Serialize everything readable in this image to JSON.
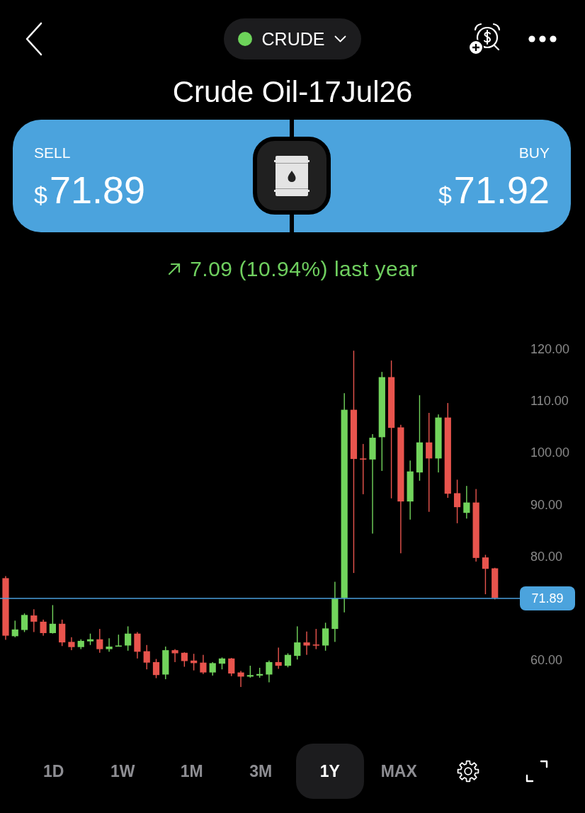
{
  "header": {
    "symbol": "CRUDE",
    "market_open": true
  },
  "title": "Crude Oil-17Jul26",
  "quotes": [
    {
      "kind": "sell",
      "label": "SELL",
      "currency": "$",
      "price": "71.89"
    },
    {
      "kind": "buy",
      "label": "BUY",
      "currency": "$",
      "price": "71.92"
    }
  ],
  "change": {
    "positive": true,
    "text": "7.09 (10.94%) last year"
  },
  "chart": {
    "chart_data": {
      "type": "candlestick",
      "ylim": [
        60,
        120
      ],
      "yticks": [
        {
          "value": 60,
          "label": "60.00"
        },
        {
          "value": 80,
          "label": "80.00"
        },
        {
          "value": 90,
          "label": "90.00"
        },
        {
          "value": 100,
          "label": "100.00"
        },
        {
          "value": 110,
          "label": "110.00"
        },
        {
          "value": 120,
          "label": "120.00"
        }
      ],
      "ref_lines": [
        {
          "axis": "y",
          "value": 71.89,
          "label": "71.89"
        }
      ],
      "ohlc": [
        [
          75.8,
          76.2,
          63.9,
          64.7
        ],
        [
          64.6,
          67.6,
          64.4,
          65.9
        ],
        [
          65.8,
          69.0,
          65.4,
          68.7
        ],
        [
          68.6,
          69.8,
          65.4,
          67.4
        ],
        [
          67.4,
          67.8,
          64.7,
          65.2
        ],
        [
          65.2,
          70.6,
          65.1,
          67.0
        ],
        [
          67.0,
          67.8,
          62.7,
          63.4
        ],
        [
          63.5,
          64.4,
          61.9,
          62.5
        ],
        [
          62.5,
          64.0,
          62.1,
          63.7
        ],
        [
          63.6,
          65.1,
          62.9,
          64.0
        ],
        [
          64.0,
          66.0,
          61.4,
          62.1
        ],
        [
          62.1,
          64.2,
          61.6,
          62.6
        ],
        [
          62.6,
          64.9,
          62.6,
          62.8
        ],
        [
          62.8,
          66.5,
          61.8,
          65.1
        ],
        [
          65.1,
          65.4,
          60.3,
          61.6
        ],
        [
          61.7,
          62.9,
          58.2,
          59.5
        ],
        [
          59.6,
          60.2,
          56.5,
          57.1
        ],
        [
          57.2,
          62.6,
          56.3,
          61.9
        ],
        [
          61.9,
          62.1,
          59.6,
          61.3
        ],
        [
          61.4,
          61.5,
          58.7,
          59.8
        ],
        [
          59.9,
          61.2,
          58.0,
          59.4
        ],
        [
          59.5,
          61.0,
          57.3,
          57.6
        ],
        [
          57.6,
          59.6,
          57.0,
          59.4
        ],
        [
          59.3,
          60.5,
          58.2,
          60.3
        ],
        [
          60.3,
          60.4,
          56.9,
          57.4
        ],
        [
          57.6,
          57.9,
          54.8,
          56.8
        ],
        [
          56.8,
          58.9,
          56.6,
          57.1
        ],
        [
          57.0,
          58.5,
          56.6,
          57.3
        ],
        [
          57.2,
          59.9,
          55.7,
          59.6
        ],
        [
          59.6,
          62.4,
          58.3,
          58.9
        ],
        [
          58.9,
          61.3,
          58.6,
          61.0
        ],
        [
          60.8,
          66.5,
          60.1,
          63.4
        ],
        [
          63.4,
          65.5,
          61.0,
          62.8
        ],
        [
          63.0,
          66.0,
          62.1,
          62.8
        ],
        [
          62.8,
          67.2,
          61.8,
          66.1
        ],
        [
          66.0,
          75.1,
          63.5,
          71.9
        ],
        [
          72.0,
          111.5,
          69.2,
          108.3
        ],
        [
          108.3,
          119.7,
          76.8,
          98.8
        ],
        [
          98.9,
          101.7,
          92.0,
          98.7
        ],
        [
          98.7,
          103.6,
          84.4,
          102.9
        ],
        [
          103.0,
          115.6,
          96.5,
          114.6
        ],
        [
          114.6,
          117.8,
          91.2,
          104.8
        ],
        [
          104.9,
          105.4,
          80.6,
          90.6
        ],
        [
          90.6,
          98.5,
          87.1,
          96.4
        ],
        [
          96.2,
          111.1,
          94.6,
          102.0
        ],
        [
          102.0,
          107.7,
          88.6,
          98.9
        ],
        [
          98.9,
          107.4,
          96.2,
          106.8
        ],
        [
          106.8,
          109.6,
          91.3,
          92.1
        ],
        [
          92.2,
          94.8,
          86.4,
          89.5
        ],
        [
          88.4,
          93.6,
          87.3,
          90.4
        ],
        [
          90.4,
          93.0,
          79.0,
          79.7
        ],
        [
          79.8,
          80.3,
          72.7,
          77.6
        ],
        [
          77.7,
          77.8,
          71.7,
          72.0
        ]
      ]
    }
  },
  "ranges": [
    {
      "label": "1D",
      "selected": false
    },
    {
      "label": "1W",
      "selected": false
    },
    {
      "label": "1M",
      "selected": false
    },
    {
      "label": "3M",
      "selected": false
    },
    {
      "label": "1Y",
      "selected": true
    },
    {
      "label": "MAX",
      "selected": false
    }
  ]
}
